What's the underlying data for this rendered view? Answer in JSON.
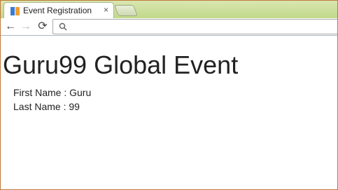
{
  "browser": {
    "tab": {
      "title": "Event Registration",
      "close": "×",
      "favicon": "logo-icon"
    },
    "nav": {
      "back": "←",
      "forward": "→",
      "reload": "⟳"
    },
    "address": {
      "value": "",
      "placeholder": ""
    }
  },
  "page": {
    "title": "Guru99 Global Event",
    "fields": [
      {
        "text": "First Name : Guru"
      },
      {
        "text": "Last Name : 99"
      }
    ]
  },
  "colors": {
    "frame_border": "#c0793a",
    "tabstrip": "#c2d98b"
  }
}
